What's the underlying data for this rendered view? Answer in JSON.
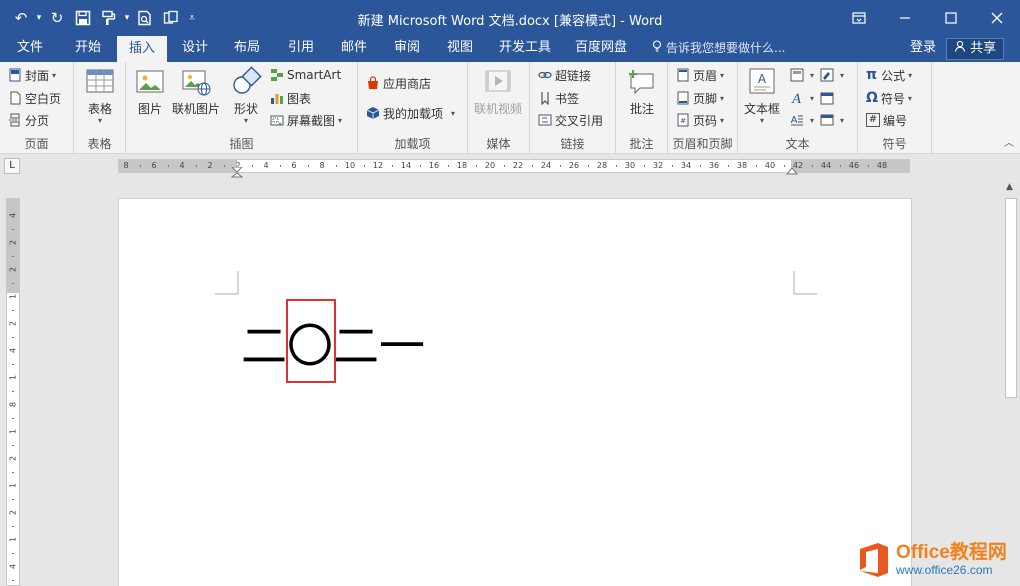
{
  "title": "新建 Microsoft Word 文档.docx [兼容模式] - Word",
  "qat": {
    "undo": "↶",
    "dd": "▾",
    "redo": "↻",
    "more": "⩡"
  },
  "tabs": [
    {
      "label": "文件"
    },
    {
      "label": "开始"
    },
    {
      "label": "插入"
    },
    {
      "label": "设计"
    },
    {
      "label": "布局"
    },
    {
      "label": "引用"
    },
    {
      "label": "邮件"
    },
    {
      "label": "审阅"
    },
    {
      "label": "视图"
    },
    {
      "label": "开发工具"
    },
    {
      "label": "百度网盘"
    }
  ],
  "tell_me": "告诉我您想要做什么...",
  "sign_in": "登录",
  "share": "共享",
  "ribbon": {
    "pages": {
      "cover": "封面",
      "blank": "空白页",
      "break": "分页",
      "label": "页面"
    },
    "tables": {
      "table": "表格",
      "label": "表格"
    },
    "illustrations": {
      "picture": "图片",
      "online_picture": "联机图片",
      "shapes": "形状",
      "smartart": "SmartArt",
      "chart": "图表",
      "screenshot": "屏幕截图",
      "label": "插图"
    },
    "addins": {
      "store": "应用商店",
      "my_addins": "我的加载项",
      "label": "加载项"
    },
    "media": {
      "online_video": "联机视频",
      "label": "媒体"
    },
    "links": {
      "hyperlink": "超链接",
      "bookmark": "书签",
      "cross_ref": "交叉引用",
      "label": "链接"
    },
    "comments": {
      "comment": "批注",
      "label": "批注"
    },
    "header_footer": {
      "header": "页眉",
      "footer": "页脚",
      "page_number": "页码",
      "label": "页眉和页脚"
    },
    "text": {
      "textbox": "文本框",
      "label": "文本"
    },
    "symbols": {
      "equation": "公式",
      "symbol": "符号",
      "numbering": "编号",
      "label": "符号",
      "pi": "π",
      "omega": "Ω",
      "hash": "#"
    }
  },
  "ruler": {
    "h_numbers": [
      "8",
      "6",
      "4",
      "2",
      "2",
      "4",
      "6",
      "8",
      "10",
      "12",
      "14",
      "16",
      "18",
      "20",
      "22",
      "24",
      "26",
      "28",
      "30",
      "32",
      "34",
      "36",
      "38",
      "40",
      "42",
      "44",
      "46",
      "48"
    ],
    "v_numbers": [
      "4",
      "2",
      "2",
      "1",
      "2",
      "4",
      "1",
      "8",
      "1",
      "2",
      "1",
      "2",
      "1",
      "4"
    ],
    "tab_selector": "L"
  },
  "document": {
    "text": "二〇二一"
  },
  "watermark": {
    "brand": "Office教程网",
    "url": "www.office26.com",
    "colors": {
      "orange": "#f0821e",
      "blue": "#2a76bd"
    }
  },
  "colors": {
    "word_blue": "#2b579a",
    "highlight_red": "#e03131"
  }
}
